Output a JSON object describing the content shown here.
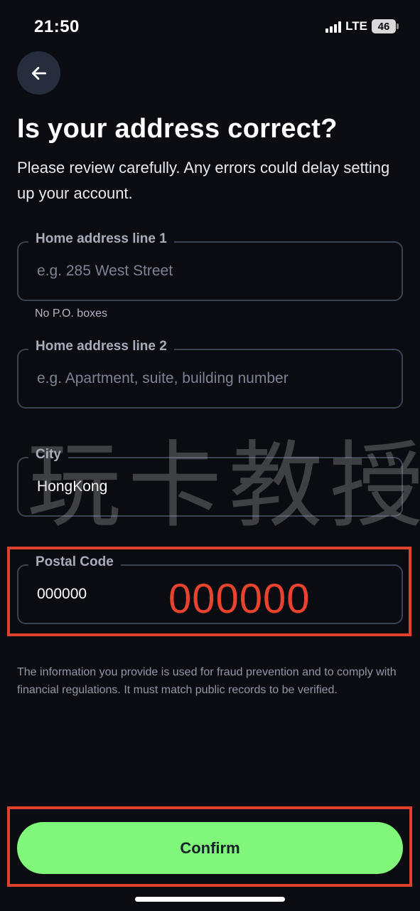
{
  "status_bar": {
    "time": "21:50",
    "network": "LTE",
    "battery": "46"
  },
  "header": {
    "back_icon": "arrow-left-icon",
    "title": "Is your address correct?",
    "subtitle": "Please review carefully. Any errors could delay setting up your account."
  },
  "form": {
    "address_line1": {
      "label": "Home address line 1",
      "placeholder": "e.g. 285 West Street",
      "value": "",
      "helper": "No P.O. boxes"
    },
    "address_line2": {
      "label": "Home address line 2",
      "placeholder": "e.g. Apartment, suite, building number",
      "value": ""
    },
    "city": {
      "label": "City",
      "value": "HongKong"
    },
    "postal_code": {
      "label": "Postal Code",
      "value": "000000"
    }
  },
  "annotation": {
    "postal_code_callout": "000000",
    "color": "#e0412f"
  },
  "watermark": "玩卡教授",
  "disclaimer": "The information you provide is used for fraud prevention and to comply with financial regulations. It must match public records to be verified.",
  "actions": {
    "confirm_label": "Confirm"
  },
  "colors": {
    "background": "#0a0c12",
    "accent": "#80f77a",
    "field_border": "#3b4255"
  }
}
